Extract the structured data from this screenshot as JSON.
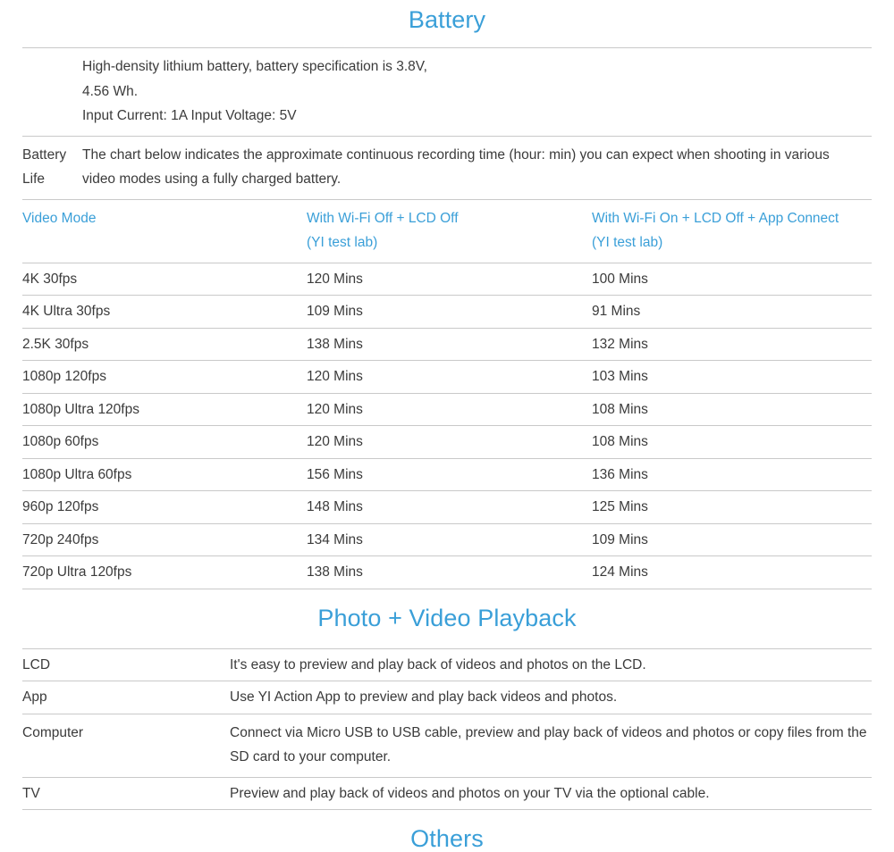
{
  "sections": {
    "battery": {
      "heading": "Battery",
      "spec_lines": [
        "High-density lithium battery, battery specification is 3.8V,",
        "4.56 Wh.",
        "Input Current: 1A Input Voltage: 5V"
      ],
      "battery_life": {
        "label": "Battery Life",
        "description": "The chart below indicates the approximate continuous recording time (hour: min) you can expect when shooting in various video modes using a fully charged battery."
      }
    },
    "playback": {
      "heading": "Photo + Video Playback",
      "rows": [
        {
          "label": "LCD",
          "description": "It's easy to preview and play back of videos and photos on the LCD."
        },
        {
          "label": "App",
          "description": "Use YI Action App to preview and play back videos and photos."
        },
        {
          "label": "Computer",
          "description": "Connect via Micro USB to USB cable, preview and play back of videos and photos or copy files from the SD card to your computer."
        },
        {
          "label": "TV",
          "description": "Preview and play back of videos and photos on your TV via the optional cable."
        }
      ]
    },
    "others": {
      "heading": "Others"
    }
  },
  "chart_data": {
    "type": "table",
    "title": "Battery Life",
    "columns": [
      "Video Mode",
      "With Wi-Fi Off + LCD Off (YI test lab)",
      "With Wi-Fi On + LCD Off + App Connect (YI test lab)"
    ],
    "column_headers": [
      {
        "line1": "Video Mode",
        "line2": ""
      },
      {
        "line1": "With Wi-Fi Off + LCD Off",
        "line2": "(YI test lab)"
      },
      {
        "line1": "With Wi-Fi On + LCD Off + App Connect",
        "line2": "(YI test lab)"
      }
    ],
    "categories": [
      "4K 30fps",
      "4K Ultra 30fps",
      "2.5K 30fps",
      "1080p 120fps",
      "1080p Ultra 120fps",
      "1080p 60fps",
      "1080p Ultra 60fps",
      "960p 120fps",
      "720p 240fps",
      "720p Ultra 120fps"
    ],
    "series": [
      {
        "name": "With Wi-Fi Off + LCD Off (YI test lab)",
        "unit": "Mins",
        "values": [
          120,
          109,
          138,
          120,
          120,
          120,
          156,
          148,
          134,
          138
        ]
      },
      {
        "name": "With Wi-Fi On + LCD Off + App Connect (YI test lab)",
        "unit": "Mins",
        "values": [
          100,
          91,
          132,
          103,
          108,
          108,
          136,
          125,
          109,
          124
        ]
      }
    ],
    "rows": [
      {
        "mode": "4K 30fps",
        "wifi_off": "120 Mins",
        "wifi_on": "100 Mins"
      },
      {
        "mode": "4K Ultra 30fps",
        "wifi_off": "109 Mins",
        "wifi_on": "91 Mins"
      },
      {
        "mode": "2.5K 30fps",
        "wifi_off": "138 Mins",
        "wifi_on": "132 Mins"
      },
      {
        "mode": "1080p 120fps",
        "wifi_off": "120 Mins",
        "wifi_on": "103 Mins"
      },
      {
        "mode": "1080p Ultra 120fps",
        "wifi_off": "120 Mins",
        "wifi_on": "108 Mins"
      },
      {
        "mode": "1080p 60fps",
        "wifi_off": "120 Mins",
        "wifi_on": "108 Mins"
      },
      {
        "mode": "1080p Ultra 60fps",
        "wifi_off": "156 Mins",
        "wifi_on": "136 Mins"
      },
      {
        "mode": "960p 120fps",
        "wifi_off": "148 Mins",
        "wifi_on": "125 Mins"
      },
      {
        "mode": "720p 240fps",
        "wifi_off": "134 Mins",
        "wifi_on": "109 Mins"
      },
      {
        "mode": "720p Ultra 120fps",
        "wifi_off": "138 Mins",
        "wifi_on": "124 Mins"
      }
    ],
    "xlabel": "",
    "ylabel": "",
    "grid": true,
    "legend": "none"
  },
  "colors": {
    "heading_blue": "#3a9fd8",
    "label_blue": "#3a9fd8",
    "body_text": "#3b3b3b",
    "rule": "#c9c9c9",
    "background": "#ffffff"
  }
}
